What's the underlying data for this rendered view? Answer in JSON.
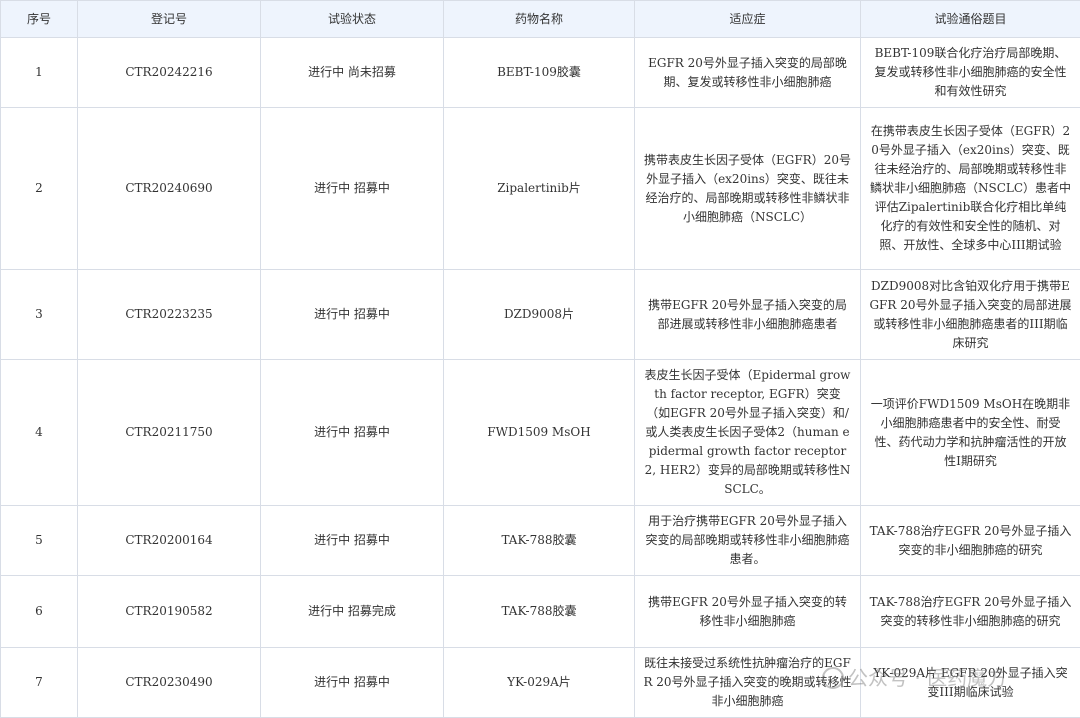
{
  "table": {
    "headers": [
      "序号",
      "登记号",
      "试验状态",
      "药物名称",
      "适应症",
      "试验通俗题目"
    ],
    "rows": [
      {
        "no": "1",
        "reg": "CTR20242216",
        "status": "进行中 尚未招募",
        "drug": "BEBT-109胶囊",
        "indication": "EGFR 20号外显子插入突变的局部晚期、复发或转移性非小细胞肺癌",
        "title": "BEBT-109联合化疗治疗局部晚期、复发或转移性非小细胞肺癌的安全性和有效性研究"
      },
      {
        "no": "2",
        "reg": "CTR20240690",
        "status": "进行中 招募中",
        "drug": "Zipalertinib片",
        "indication": "携带表皮生长因子受体（EGFR）20号外显子插入（ex20ins）突变、既往未经治疗的、局部晚期或转移性非鳞状非小细胞肺癌（NSCLC）",
        "title": "在携带表皮生长因子受体（EGFR）20号外显子插入（ex20ins）突变、既往未经治疗的、局部晚期或转移性非鳞状非小细胞肺癌（NSCLC）患者中评估Zipalertinib联合化疗相比单纯化疗的有效性和安全性的随机、对照、开放性、全球多中心III期试验"
      },
      {
        "no": "3",
        "reg": "CTR20223235",
        "status": "进行中 招募中",
        "drug": "DZD9008片",
        "indication": "携带EGFR 20号外显子插入突变的局部进展或转移性非小细胞肺癌患者",
        "title": "DZD9008对比含铂双化疗用于携带EGFR 20号外显子插入突变的局部进展或转移性非小细胞肺癌患者的III期临床研究"
      },
      {
        "no": "4",
        "reg": "CTR20211750",
        "status": "进行中 招募中",
        "drug": "FWD1509 MsOH",
        "indication": "表皮生长因子受体（Epidermal growth factor receptor, EGFR）突变（如EGFR 20号外显子插入突变）和/或人类表皮生长因子受体2（human epidermal growth factor receptor 2, HER2）变异的局部晚期或转移性NSCLC。",
        "title": "一项评价FWD1509 MsOH在晚期非小细胞肺癌患者中的安全性、耐受性、药代动力学和抗肿瘤活性的开放性I期研究"
      },
      {
        "no": "5",
        "reg": "CTR20200164",
        "status": "进行中 招募中",
        "drug": "TAK-788胶囊",
        "indication": "用于治疗携带EGFR 20号外显子插入突变的局部晚期或转移性非小细胞肺癌患者。",
        "title": "TAK-788治疗EGFR 20号外显子插入突变的非小细胞肺癌的研究"
      },
      {
        "no": "6",
        "reg": "CTR20190582",
        "status": "进行中 招募完成",
        "drug": "TAK-788胶囊",
        "indication": "携带EGFR 20号外显子插入突变的转移性非小细胞肺癌",
        "title": "TAK-788治疗EGFR 20号外显子插入突变的转移性非小细胞肺癌的研究"
      },
      {
        "no": "7",
        "reg": "CTR20230490",
        "status": "进行中 招募中",
        "drug": "YK-029A片",
        "indication": "既往未接受过系统性抗肿瘤治疗的EGFR 20号外显子插入突变的晚期或转移性非小细胞肺癌",
        "title": "YK-029A片 EGFR 20外显子插入突变III期临床试验"
      }
    ]
  },
  "watermark": {
    "text": "公众号 · 医药魔方",
    "icon": "wechat-icon"
  }
}
